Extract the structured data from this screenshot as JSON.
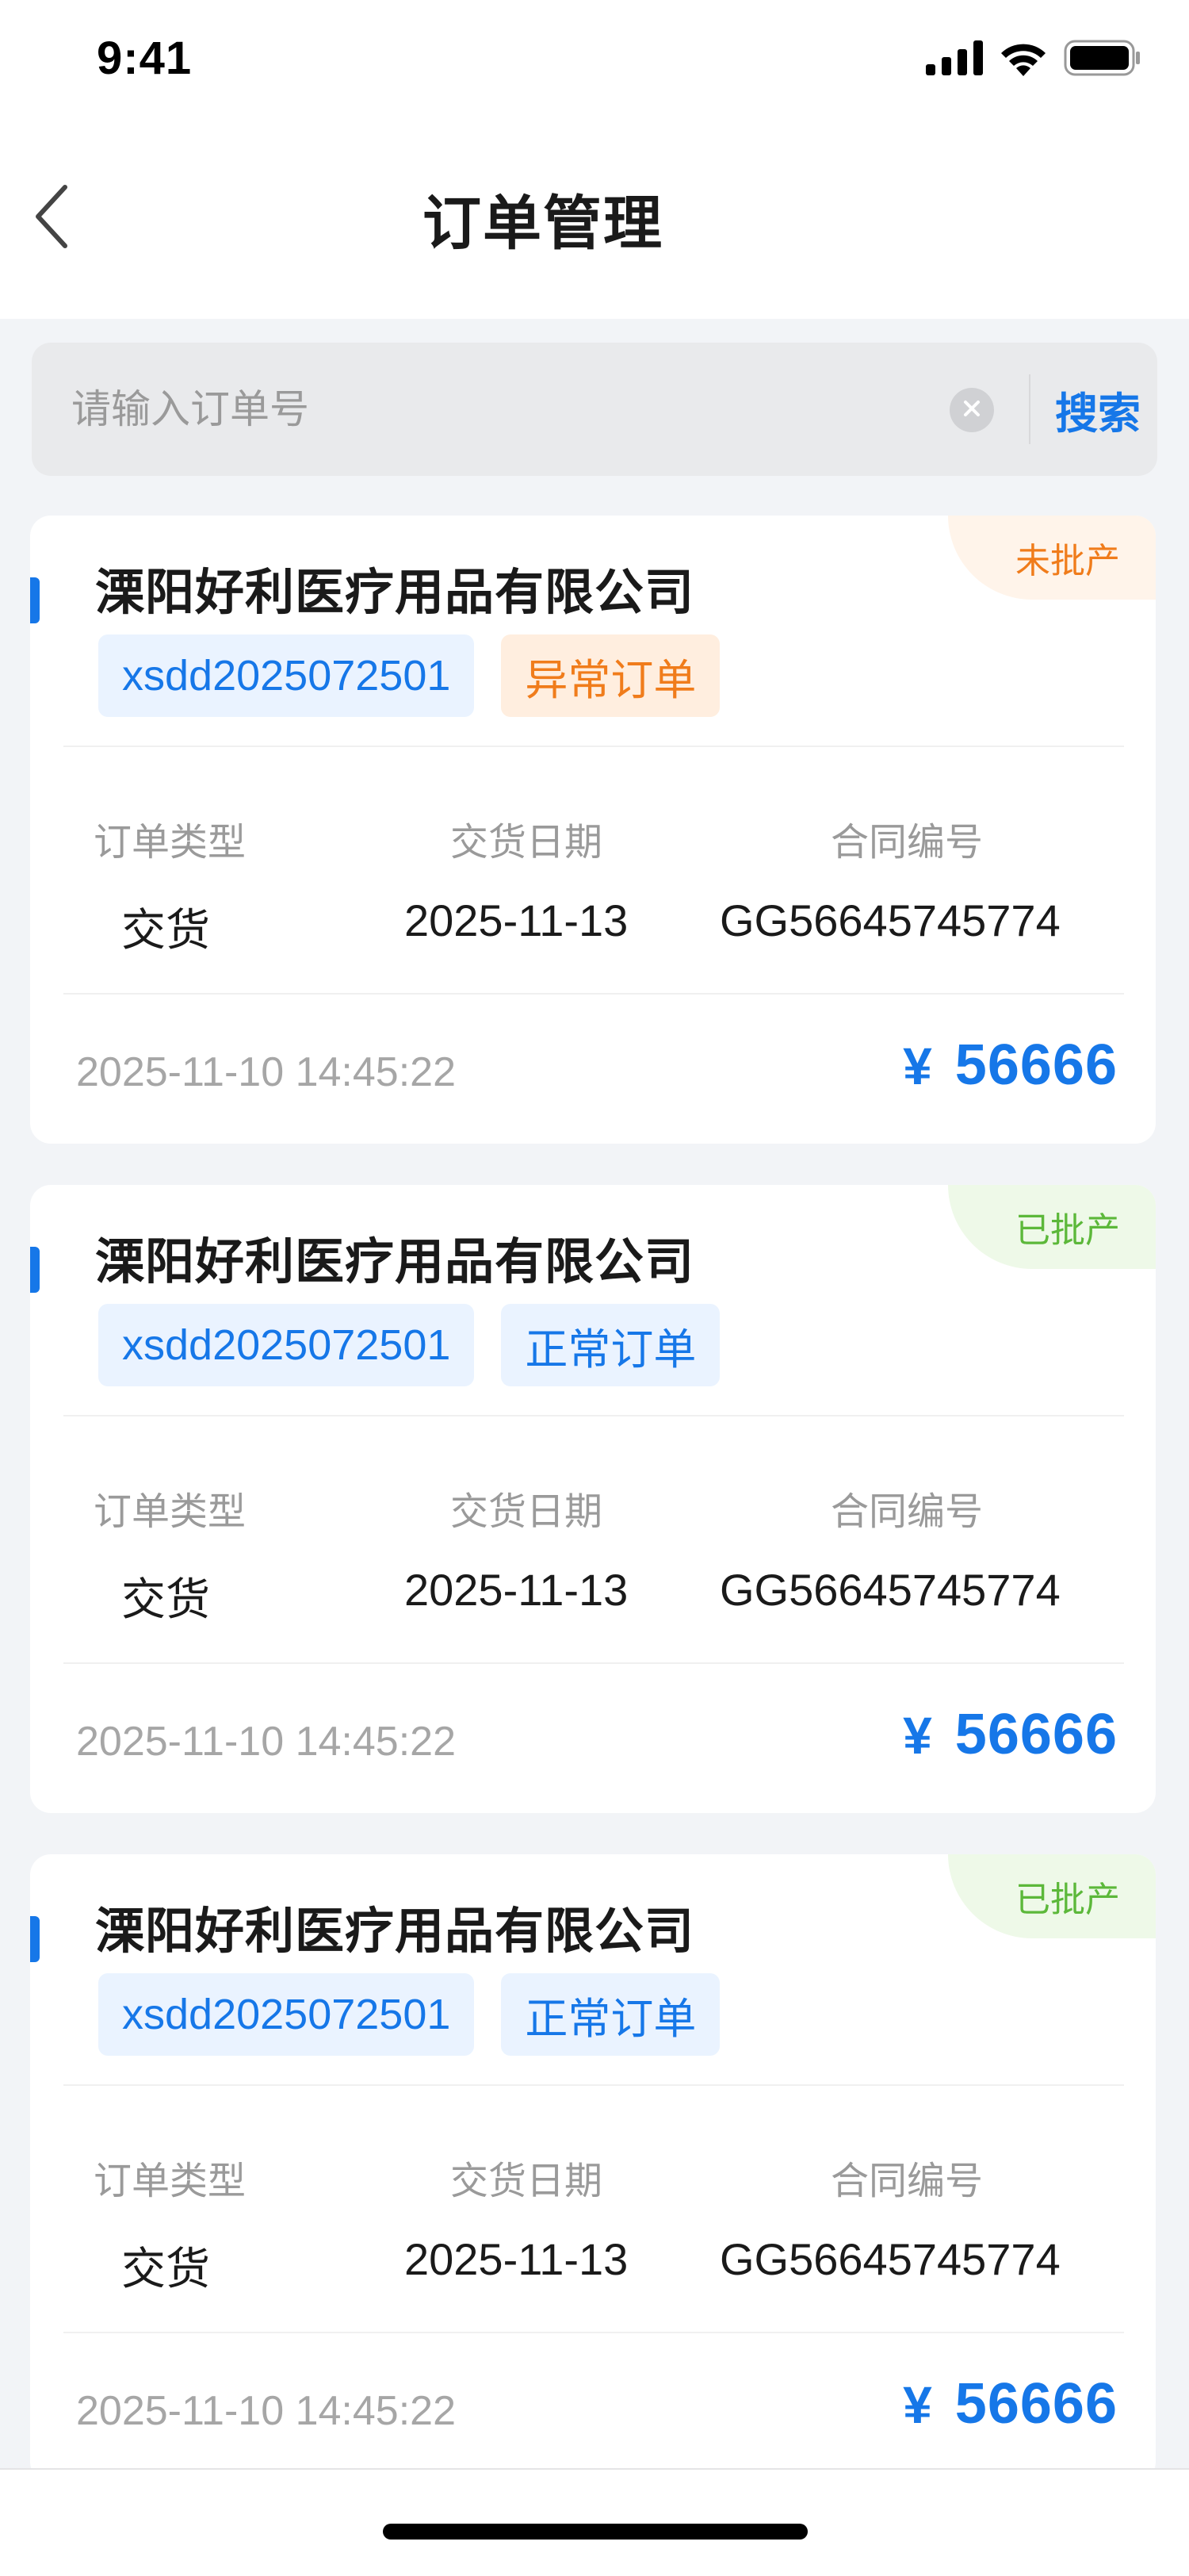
{
  "status_bar": {
    "time": "9:41"
  },
  "nav": {
    "title": "订单管理"
  },
  "search": {
    "placeholder": "请输入订单号",
    "button_label": "搜索"
  },
  "labels": {
    "order_type": "订单类型",
    "delivery_date": "交货日期",
    "contract_no": "合同编号"
  },
  "colors": {
    "accent": "#1677E8",
    "pending": "#F07C1B",
    "approved": "#5CB83A"
  },
  "orders": [
    {
      "status": "未批产",
      "company": "溧阳好利医疗用品有限公司",
      "order_no": "xsdd2025072501",
      "order_kind": "异常订单",
      "order_type": "交货",
      "delivery_date": "2025-11-13",
      "contract_no": "GG56645745774",
      "created_at": "2025-11-10 14:45:22",
      "currency": "¥",
      "amount": "56666"
    },
    {
      "status": "已批产",
      "company": "溧阳好利医疗用品有限公司",
      "order_no": "xsdd2025072501",
      "order_kind": "正常订单",
      "order_type": "交货",
      "delivery_date": "2025-11-13",
      "contract_no": "GG56645745774",
      "created_at": "2025-11-10 14:45:22",
      "currency": "¥",
      "amount": "56666"
    },
    {
      "status": "已批产",
      "company": "溧阳好利医疗用品有限公司",
      "order_no": "xsdd2025072501",
      "order_kind": "正常订单",
      "order_type": "交货",
      "delivery_date": "2025-11-13",
      "contract_no": "GG56645745774",
      "created_at": "2025-11-10 14:45:22",
      "currency": "¥",
      "amount": "56666"
    }
  ]
}
